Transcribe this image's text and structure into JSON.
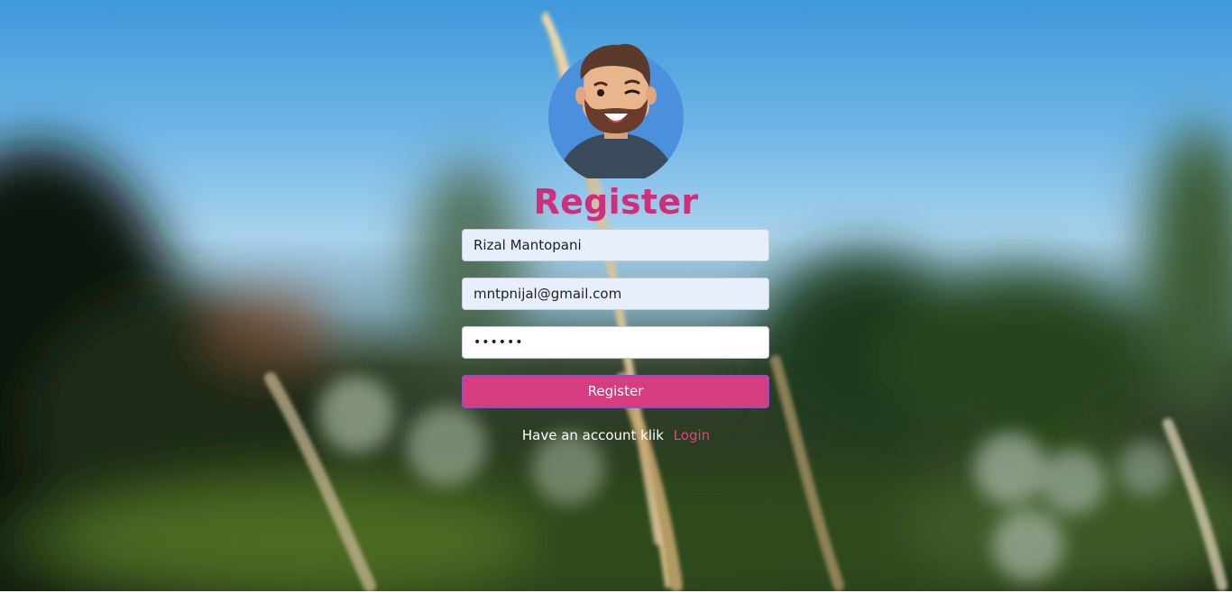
{
  "background": {
    "icon": "blurred-grass-photo",
    "sky_color": "#5aa6e0",
    "foliage_color": "#1f2a16"
  },
  "avatar": {
    "icon": "winking-bearded-man-avatar",
    "circle_color": "#4a90dd"
  },
  "form": {
    "title": "Register",
    "title_color": "#cf2f7a",
    "name_value": "Rizal Mantopani",
    "email_value": "mntpnijal@gmail.com",
    "password_value": "••••••",
    "submit_label": "Register",
    "submit_color": "#d63c80"
  },
  "footer": {
    "text": "Have an account klik",
    "link_label": "Login",
    "link_color": "#e2407e"
  }
}
